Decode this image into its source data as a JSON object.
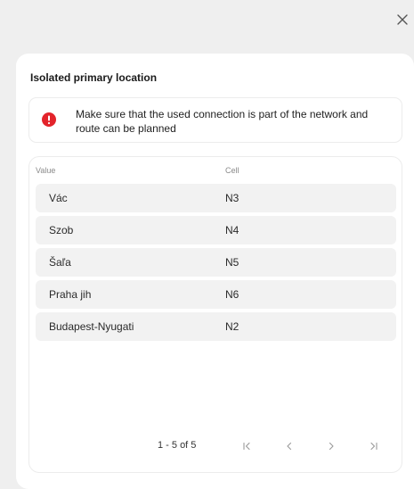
{
  "dialog": {
    "close_icon": "close-icon",
    "title": "Isolated primary location"
  },
  "alert": {
    "icon": "error-icon",
    "color": "#e3242b",
    "message": "Make sure that the used connection is part of the network and route can be planned"
  },
  "table": {
    "columns": [
      "Value",
      "Cell"
    ],
    "rows": [
      {
        "value": "Vác",
        "cell": "N3"
      },
      {
        "value": "Szob",
        "cell": "N4"
      },
      {
        "value": "Šaľa",
        "cell": "N5"
      },
      {
        "value": "Praha jih",
        "cell": "N6"
      },
      {
        "value": "Budapest-Nyugati",
        "cell": "N2"
      }
    ]
  },
  "pagination": {
    "range_label": "1 - 5 of 5",
    "first_icon": "first-page-icon",
    "prev_icon": "chevron-left-icon",
    "next_icon": "chevron-right-icon",
    "last_icon": "last-page-icon"
  }
}
